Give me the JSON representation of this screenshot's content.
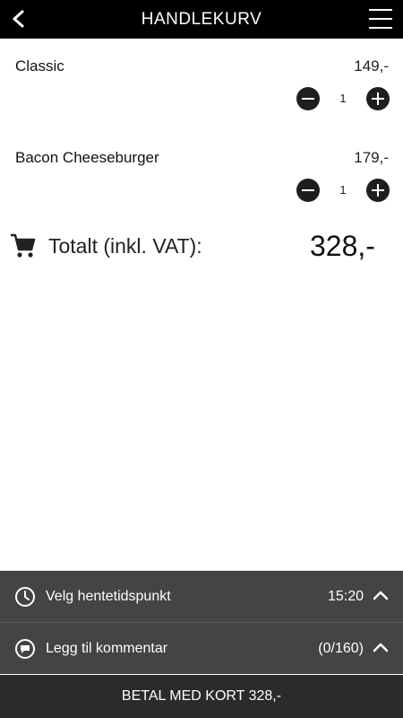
{
  "header": {
    "title": "HANDLEKURV"
  },
  "cart": {
    "items": [
      {
        "name": "Classic",
        "price": "149,-",
        "quantity": "1"
      },
      {
        "name": "Bacon Cheeseburger",
        "price": "179,-",
        "quantity": "1"
      }
    ],
    "total_label": "Totalt (inkl. VAT):",
    "total_amount": "328,-"
  },
  "pickup": {
    "label": "Velg hentetidspunkt",
    "value": "15:20"
  },
  "comment": {
    "label": "Legg til kommentar",
    "value": "(0/160)"
  },
  "pay_button": {
    "label": "BETAL MED KORT 328,-"
  }
}
